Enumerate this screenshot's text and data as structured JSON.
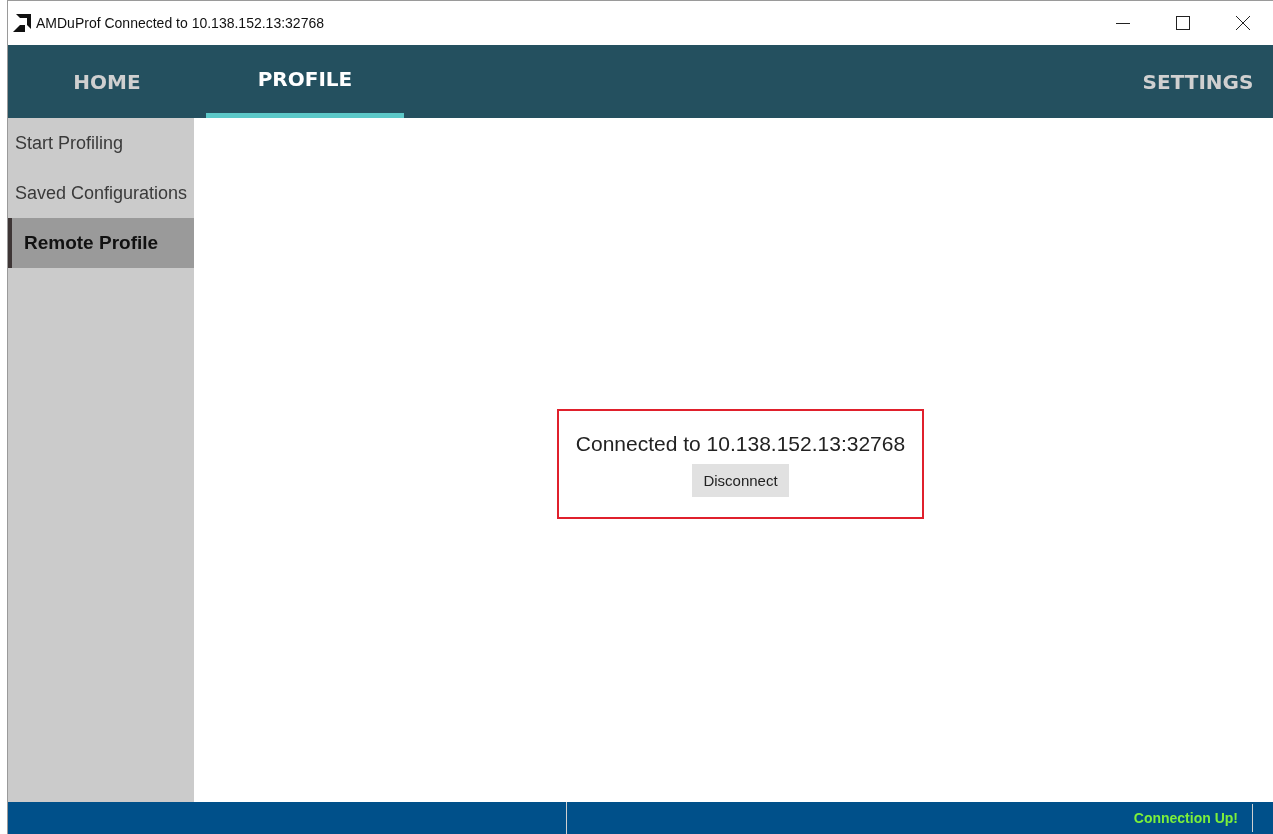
{
  "window": {
    "title": "AMDuProf Connected to 10.138.152.13:32768"
  },
  "tabs": [
    {
      "label": "HOME",
      "selected": false
    },
    {
      "label": "PROFILE",
      "selected": true
    }
  ],
  "settings": {
    "label": "SETTINGS"
  },
  "sidebar": {
    "items": [
      {
        "label": "Start Profiling",
        "selected": false
      },
      {
        "label": "Saved Configurations",
        "selected": false
      },
      {
        "label": "Remote Profile",
        "selected": true
      }
    ]
  },
  "connection": {
    "message": "Connected to 10.138.152.13:32768",
    "button": "Disconnect",
    "highlighted": true
  },
  "status_bar": {
    "text": "Connection Up!"
  }
}
